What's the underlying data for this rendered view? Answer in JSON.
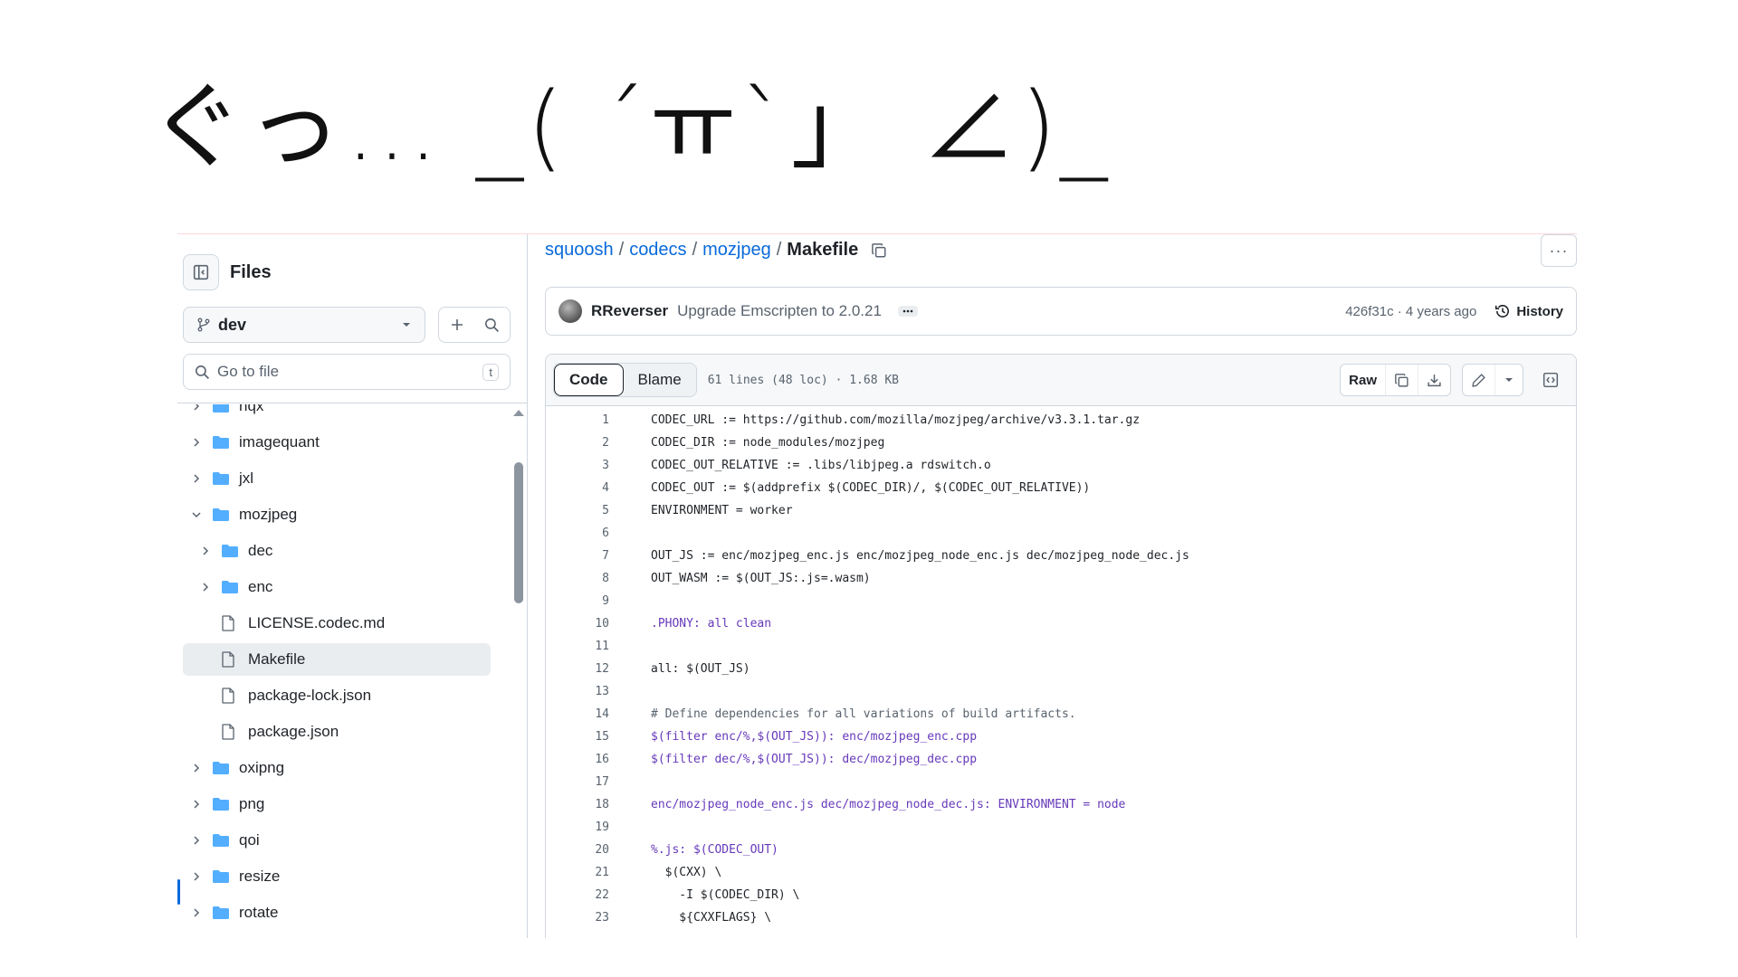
{
  "kaomoji": "ぐっ… _( ´ㅠ`」 ∠)_",
  "sidebar": {
    "title": "Files",
    "branch": "dev",
    "goto_placeholder": "Go to file",
    "goto_shortcut": "t",
    "tree": [
      {
        "label": "hqx",
        "type": "folder",
        "depth": 0,
        "expanded": false
      },
      {
        "label": "imagequant",
        "type": "folder",
        "depth": 0,
        "expanded": false
      },
      {
        "label": "jxl",
        "type": "folder",
        "depth": 0,
        "expanded": false
      },
      {
        "label": "mozjpeg",
        "type": "folder",
        "depth": 0,
        "expanded": true
      },
      {
        "label": "dec",
        "type": "folder",
        "depth": 1,
        "expanded": false
      },
      {
        "label": "enc",
        "type": "folder",
        "depth": 1,
        "expanded": false
      },
      {
        "label": "LICENSE.codec.md",
        "type": "file",
        "depth": 1
      },
      {
        "label": "Makefile",
        "type": "file",
        "depth": 1,
        "selected": true
      },
      {
        "label": "package-lock.json",
        "type": "file",
        "depth": 1
      },
      {
        "label": "package.json",
        "type": "file",
        "depth": 1
      },
      {
        "label": "oxipng",
        "type": "folder",
        "depth": 0,
        "expanded": false
      },
      {
        "label": "png",
        "type": "folder",
        "depth": 0,
        "expanded": false
      },
      {
        "label": "qoi",
        "type": "folder",
        "depth": 0,
        "expanded": false
      },
      {
        "label": "resize",
        "type": "folder",
        "depth": 0,
        "expanded": false
      },
      {
        "label": "rotate",
        "type": "folder",
        "depth": 0,
        "expanded": false
      }
    ]
  },
  "breadcrumb": {
    "parts": [
      "squoosh",
      "codecs",
      "mozjpeg"
    ],
    "current": "Makefile"
  },
  "commit": {
    "author": "RReverser",
    "message": "Upgrade Emscripten to 2.0.21",
    "sha_time": "426f31c · 4 years ago",
    "history_label": "History"
  },
  "file": {
    "tab_code": "Code",
    "tab_blame": "Blame",
    "meta": "61 lines (48 loc) · 1.68 KB",
    "raw_label": "Raw",
    "lines": [
      "CODEC_URL := https://github.com/mozilla/mozjpeg/archive/v3.3.1.tar.gz",
      "CODEC_DIR := node_modules/mozjpeg",
      "CODEC_OUT_RELATIVE := .libs/libjpeg.a rdswitch.o",
      "CODEC_OUT := $(addprefix $(CODEC_DIR)/, $(CODEC_OUT_RELATIVE))",
      "ENVIRONMENT = worker",
      "",
      "OUT_JS := enc/mozjpeg_enc.js enc/mozjpeg_node_enc.js dec/mozjpeg_node_dec.js",
      "OUT_WASM := $(OUT_JS:.js=.wasm)",
      "",
      ".PHONY: all clean",
      "",
      "all: $(OUT_JS)",
      "",
      "# Define dependencies for all variations of build artifacts.",
      "$(filter enc/%,$(OUT_JS)): enc/mozjpeg_enc.cpp",
      "$(filter dec/%,$(OUT_JS)): dec/mozjpeg_dec.cpp",
      "",
      "enc/mozjpeg_node_enc.js dec/mozjpeg_node_dec.js: ENVIRONMENT = node",
      "",
      "%.js: $(CODEC_OUT)",
      "  $(CXX) \\",
      "    -I $(CODEC_DIR) \\",
      "    ${CXXFLAGS} \\"
    ]
  },
  "colors": {
    "link": "#0969da",
    "folder": "#54aeff",
    "border": "#d0d7de",
    "muted": "#59636e"
  }
}
